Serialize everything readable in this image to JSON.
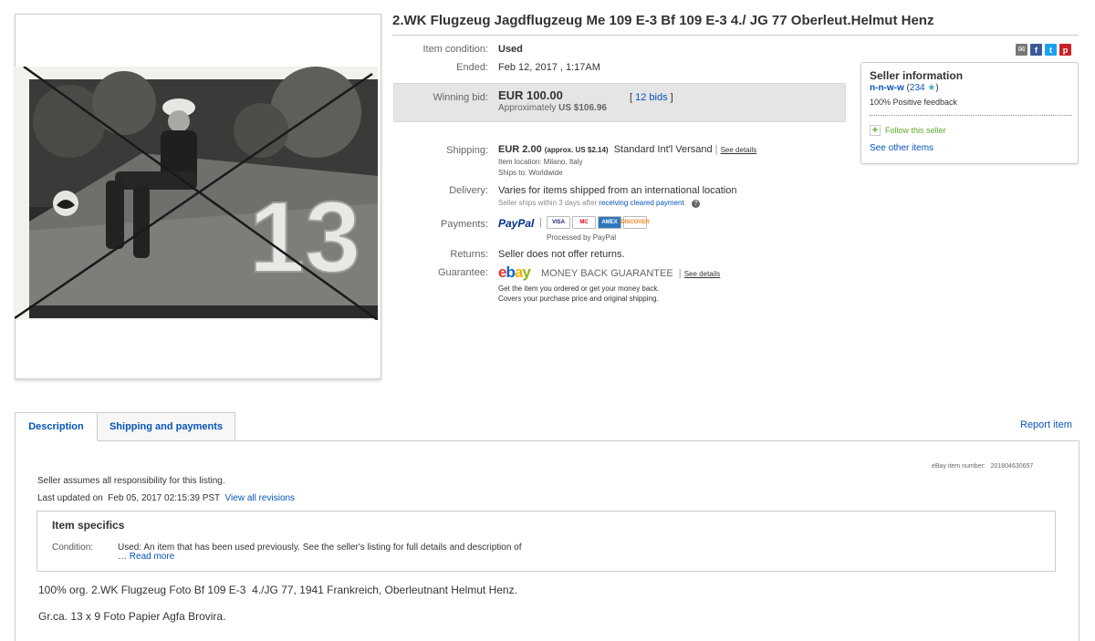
{
  "listing": {
    "title": "2.WK Flugzeug Jagdflugzeug Me 109 E-3 Bf 109 E-3 4./ JG 77 Oberleut.Helmut Henz",
    "photo_number": "13"
  },
  "details": {
    "condition_label": "Item condition:",
    "condition_value": "Used",
    "ended_label": "Ended:",
    "ended_value": "Feb 12, 2017 , 1:17AM",
    "winning_bid_label": "Winning bid:",
    "winning_bid_value": "EUR 100.00",
    "approx_prefix": "Approximately",
    "approx_value": "US $106.96",
    "bids_open": "[",
    "bids_link": "12 bids",
    "bids_close": "]",
    "shipping_label": "Shipping:",
    "shipping_value": "EUR 2.00",
    "shipping_approx": "(approx. US $2.14)",
    "shipping_service": "Standard Int'l Versand",
    "shipping_sep": "|",
    "see_details": "See details",
    "item_location": "Item location:  Milano, Italy",
    "ships_to": "Ships to:  Worldwide",
    "delivery_label": "Delivery:",
    "delivery_value": "Varies for items shipped from an international location",
    "delivery_note_prefix": "Seller ships within 3 days after",
    "delivery_note_link": "receiving cleared payment",
    "delivery_note_suffix": ".",
    "payments_label": "Payments:",
    "paypal_text": "PayPal",
    "processed_by": "Processed by PayPal",
    "returns_label": "Returns:",
    "returns_value": "Seller does not offer returns.",
    "guarantee_label": "Guarantee:",
    "guarantee_text": "MONEY BACK GUARANTEE",
    "guarantee_sep": "|",
    "guarantee_see_details": "See details",
    "guarantee_line1": "Get the item you ordered or get your money back.",
    "guarantee_line2": "Covers your purchase price and original shipping."
  },
  "payment_cards": [
    "VISA",
    "MC",
    "AMEX",
    "DISCOVER"
  ],
  "seller": {
    "heading": "Seller information",
    "name": "n-n-w-w",
    "score_open": "(",
    "score": "234",
    "score_close": ")",
    "feedback": "100% Positive feedback",
    "follow": "Follow this seller",
    "see_other": "See other items"
  },
  "tabs": {
    "description": "Description",
    "shipping": "Shipping and payments",
    "report": "Report item"
  },
  "description": {
    "item_number_label": "eBay item number:",
    "item_number": "201804630657",
    "responsibility": "Seller assumes all responsibility for this listing.",
    "updated_label": "Last updated on",
    "updated_value": "Feb 05, 2017 02:15:39 PST",
    "view_revisions": "View all revisions",
    "specifics_heading": "Item specifics",
    "condition_label": "Condition:",
    "condition_text": "Used: An item that has been used previously. See the seller's listing for full details and description of",
    "ellipsis": "…",
    "read_more": "Read more",
    "line1": "100% org. 2.WK Flugzeug Foto Bf 109 E-3  4./JG 77, 1941 Frankreich, Oberleutnant Helmut Henz.",
    "line2": "Gr.ca. 13 x 9 Foto Papier Agfa Brovira."
  },
  "colors": {
    "link": "#0654ba",
    "paypal_blue": "#003087",
    "paypal_light": "#009cde",
    "ebay_red": "#e53238",
    "ebay_blue": "#0064d2",
    "ebay_yellow": "#f5af02",
    "ebay_green": "#86b817"
  }
}
